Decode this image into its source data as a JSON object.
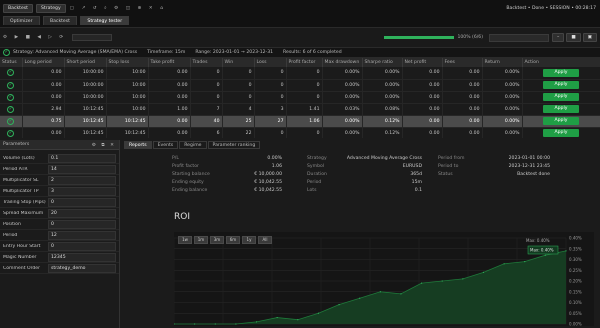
{
  "topbar": {
    "brand": "Backtest",
    "select_label": "Strategy",
    "right_text": "Backtest • Done • SESSION • 00:28:17",
    "tabs": [
      "Optimizer",
      "Backtest",
      "Strategy tester"
    ]
  },
  "toolbar": {
    "progress_text": "100% (6/6)",
    "right_buttons": [
      "–",
      "■",
      "▣"
    ]
  },
  "info": {
    "items": [
      "Strategy: Advanced Moving Average (SMA/EMA) Cross",
      "Timeframe: 15m",
      "Range: 2023-01-01 → 2023-12-31",
      "Results: 6 of 6 completed"
    ]
  },
  "grid": {
    "columns": [
      "Status",
      "Long period",
      "Short period",
      "Stop loss",
      "Take profit",
      "Trades",
      "Win",
      "Loss",
      "Profit factor",
      "Max drawdown",
      "Sharpe ratio",
      "Net profit",
      "Fees",
      "Return",
      "Action"
    ],
    "rows": [
      [
        "✓",
        "0.00",
        "10:00:00",
        "10:00",
        "0.00",
        "0",
        "0",
        "0",
        "0",
        "0.00%",
        "0.00%",
        "0.00",
        "0.00",
        "0.00%",
        "Apply"
      ],
      [
        "✓",
        "0.00",
        "10:00:00",
        "10:00",
        "0.00",
        "0",
        "0",
        "0",
        "0",
        "0.00%",
        "0.00%",
        "0.00",
        "0.00",
        "0.00%",
        "Apply"
      ],
      [
        "✓",
        "0.00",
        "10:00:00",
        "10:00",
        "0.00",
        "0",
        "0",
        "0",
        "0",
        "0.00%",
        "0.00%",
        "0.00",
        "0.00",
        "0.00%",
        "Apply"
      ],
      [
        "✓",
        "2.94",
        "10:12:45",
        "10:00",
        "1.00",
        "7",
        "4",
        "3",
        "1.41",
        "0.03%",
        "0.08%",
        "0.00",
        "0.00",
        "0.00%",
        "Apply"
      ],
      [
        "✓",
        "0.75",
        "10:12:45",
        "10:12:45",
        "0.00",
        "40",
        "25",
        "27",
        "1.06",
        "0.00%",
        "0.12%",
        "0.00",
        "0.00",
        "0.00%",
        "Apply"
      ],
      [
        "✓",
        "0.00",
        "10:12:45",
        "10:12:45",
        "0.00",
        "6",
        "22",
        "0",
        "0",
        "0.00%",
        "0.12%",
        "0.00",
        "0.00",
        "0.00%",
        "Apply"
      ]
    ],
    "selected_row": 4
  },
  "params": {
    "title": "Parameters",
    "items": [
      {
        "k": "Volume (Lots)",
        "v": "0.1"
      },
      {
        "k": "Period ATR",
        "v": "14"
      },
      {
        "k": "Multiplicator SL",
        "v": "2"
      },
      {
        "k": "Multiplicator TP",
        "v": "3"
      },
      {
        "k": "Trailing Stop (Pips)",
        "v": "0"
      },
      {
        "k": "Spread Maximum",
        "v": "20"
      },
      {
        "k": "Position",
        "v": "0"
      },
      {
        "k": "Period",
        "v": "12"
      },
      {
        "k": "Entry Hour Start",
        "v": "0"
      },
      {
        "k": "Magic Number",
        "v": "12345"
      },
      {
        "k": "Comment Order",
        "v": "strategy_demo"
      }
    ]
  },
  "report": {
    "tabs": [
      "Reports",
      "Events",
      "Regime",
      "Parameter ranking"
    ],
    "col1": [
      {
        "l": "P/L",
        "r": "0.00%"
      },
      {
        "l": "Profit factor",
        "r": "1.06"
      },
      {
        "l": "Starting balance",
        "r": "€ 10,000.00"
      },
      {
        "l": "Ending equity",
        "r": "€ 10,042.55"
      },
      {
        "l": "Ending balance",
        "r": "€ 10,042.55"
      }
    ],
    "col2": [
      {
        "l": "Strategy",
        "r": "Advanced Moving Average Cross"
      },
      {
        "l": "Symbol",
        "r": "EURUSD"
      },
      {
        "l": "Duration",
        "r": "365d"
      },
      {
        "l": "Period",
        "r": "15m"
      },
      {
        "l": "Lots",
        "r": "0.1"
      }
    ],
    "col3": [
      {
        "l": "Period from",
        "r": "2023-01-01 00:00"
      },
      {
        "l": "Period to",
        "r": "2023-12-31 23:45"
      },
      {
        "l": "Status",
        "r": "Backtest done"
      }
    ],
    "roi_title": "ROI",
    "ranges": [
      "1w",
      "1m",
      "3m",
      "6m",
      "1y",
      "All"
    ],
    "legend": "Max: 0.40%",
    "tooltip": "Max: 0.40%",
    "yticks": [
      "0.40%",
      "0.35%",
      "0.30%",
      "0.25%",
      "0.20%",
      "0.15%",
      "0.10%",
      "0.05%",
      "0.00%"
    ]
  },
  "chart_data": {
    "type": "area",
    "title": "ROI",
    "x": [
      0,
      1,
      2,
      3,
      4,
      5,
      6,
      7,
      8,
      9,
      10,
      11,
      12,
      13,
      14,
      15,
      16,
      17,
      18,
      19
    ],
    "series": [
      {
        "values": [
          0.0,
          0.0,
          0.0,
          0.0,
          0.01,
          0.03,
          0.02,
          0.05,
          0.09,
          0.12,
          0.15,
          0.14,
          0.19,
          0.2,
          0.21,
          0.24,
          0.28,
          0.29,
          0.32,
          0.34
        ]
      }
    ],
    "ylim": [
      0.0,
      0.4
    ],
    "grid": true,
    "colors": [
      "#1e7a3a"
    ]
  }
}
